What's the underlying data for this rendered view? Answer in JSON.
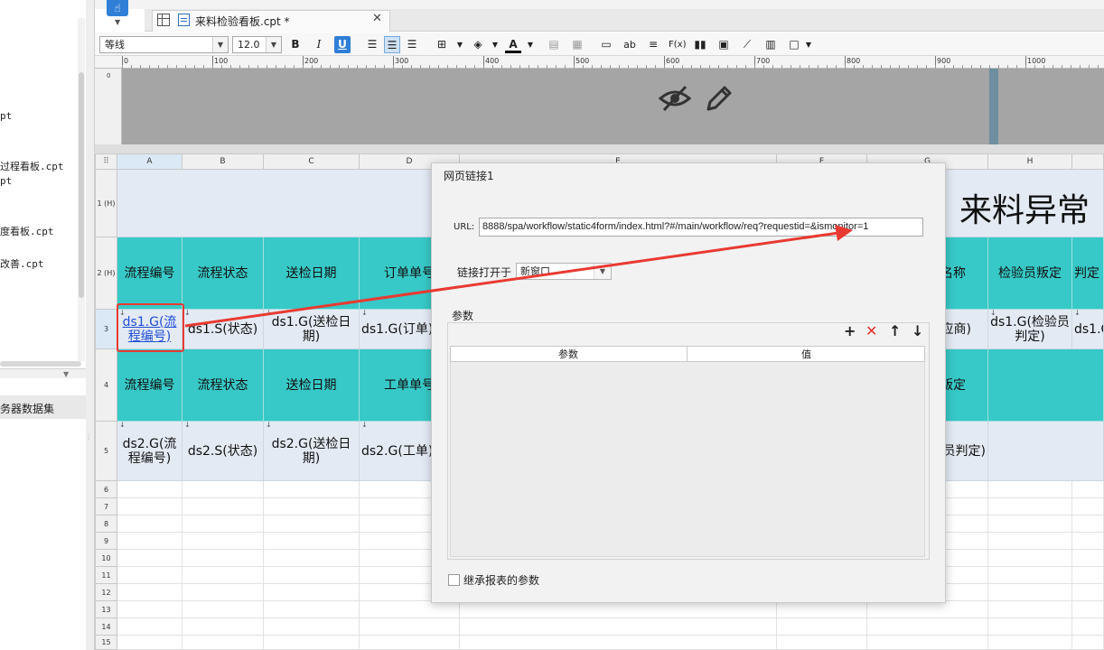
{
  "sidebar": {
    "files": [
      "pt",
      "过程看板.cpt",
      "pt",
      "度看板.cpt",
      "改善.cpt"
    ],
    "dataset_section": "务器数据集"
  },
  "tab": {
    "title": "来料检验看板.cpt *",
    "close": "✕"
  },
  "toolbar": {
    "font_name": "等线",
    "font_size": "12.0",
    "bold": "B",
    "italic": "I",
    "underline": "U",
    "text_tool": "ab",
    "formula_tool": "F(x)"
  },
  "ruler": {
    "labels": [
      "0",
      "100",
      "200",
      "300",
      "400",
      "500",
      "600",
      "700",
      "800",
      "900",
      "1000"
    ]
  },
  "grid": {
    "columns": [
      "A",
      "B",
      "C",
      "D",
      "E",
      "F",
      "G",
      "H"
    ],
    "row_labels": [
      "1 (H)",
      "2 (H)",
      "3",
      "4",
      "5",
      "6",
      "7",
      "8",
      "9",
      "10",
      "11",
      "12",
      "13",
      "14",
      "15"
    ],
    "title": "来料异常",
    "header_row1": [
      "流程编号",
      "流程状态",
      "送检日期",
      "订单单号",
      "名称",
      "检验员叛定",
      "判定"
    ],
    "data_row1": [
      "ds1.G(流程编号)",
      "ds1.S(状态)",
      "ds1.G(送检日期)",
      "ds1.G(订单)",
      "应商)",
      "ds1.G(检验员判定)",
      "ds1.G"
    ],
    "header_row2": [
      "流程编号",
      "流程状态",
      "送检日期",
      "工单单号",
      "叛定"
    ],
    "data_row2": [
      "ds2.G(流程编号)",
      "ds2.S(状态)",
      "ds2.G(送检日期)",
      "ds2.G(工单)",
      "员判定)"
    ]
  },
  "dialog": {
    "title": "网页链接1",
    "url_label": "URL:",
    "url_value": "8888/spa/workflow/static4form/index.html?#/main/workflow/req?requestid=&ismonitor=1",
    "open_in_label": "链接打开于",
    "open_in_value": "新窗口",
    "params_label": "参数",
    "add": "+",
    "delete": "✕",
    "up": "↑",
    "down": "↓",
    "col_param": "参数",
    "col_value": "值",
    "inherit_label": "继承报表的参数"
  },
  "colors": {
    "header_teal": "#37c9c7",
    "data_bg": "#e4eaf4",
    "accent_blue": "#2f7fd6",
    "arrow_red": "#e83a32"
  }
}
